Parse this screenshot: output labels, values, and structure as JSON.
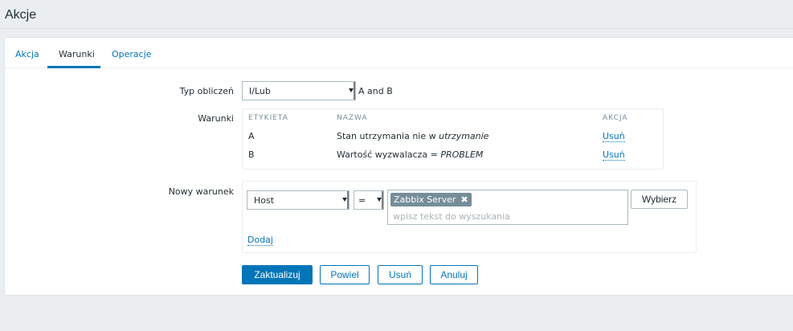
{
  "page": {
    "title": "Akcje"
  },
  "tabs": [
    {
      "label": "Akcja"
    },
    {
      "label": "Warunki"
    },
    {
      "label": "Operacje"
    }
  ],
  "form": {
    "calc_label": "Typ obliczeń",
    "calc_value": "I/Lub",
    "calc_formula": "A and B",
    "conditions_label": "Warunki",
    "conditions_table": {
      "headers": [
        "ETYKIETA",
        "NAZWA",
        "AKCJA"
      ],
      "rows": [
        {
          "label": "A",
          "name_prefix": "Stan utrzymania nie w ",
          "name_value": "utrzymanie",
          "action": "Usuń"
        },
        {
          "label": "B",
          "name_prefix": "Wartość wyzwalacza = ",
          "name_value": "PROBLEM",
          "action": "Usuń"
        }
      ]
    },
    "new_condition_label": "Nowy warunek",
    "new_condition": {
      "type_value": "Host",
      "operator_value": "=",
      "selected_chip": "Zabbix Server",
      "chip_remove": "✖",
      "search_placeholder": "wpisz tekst do wyszukania",
      "select_button": "Wybierz",
      "add_link": "Dodaj"
    },
    "buttons": {
      "update": "Zaktualizuj",
      "clone": "Powiel",
      "delete": "Usuń",
      "cancel": "Anuluj"
    }
  },
  "colors": {
    "accent": "#0275b8",
    "background": "#ebeef0",
    "chip": "#768d99"
  }
}
